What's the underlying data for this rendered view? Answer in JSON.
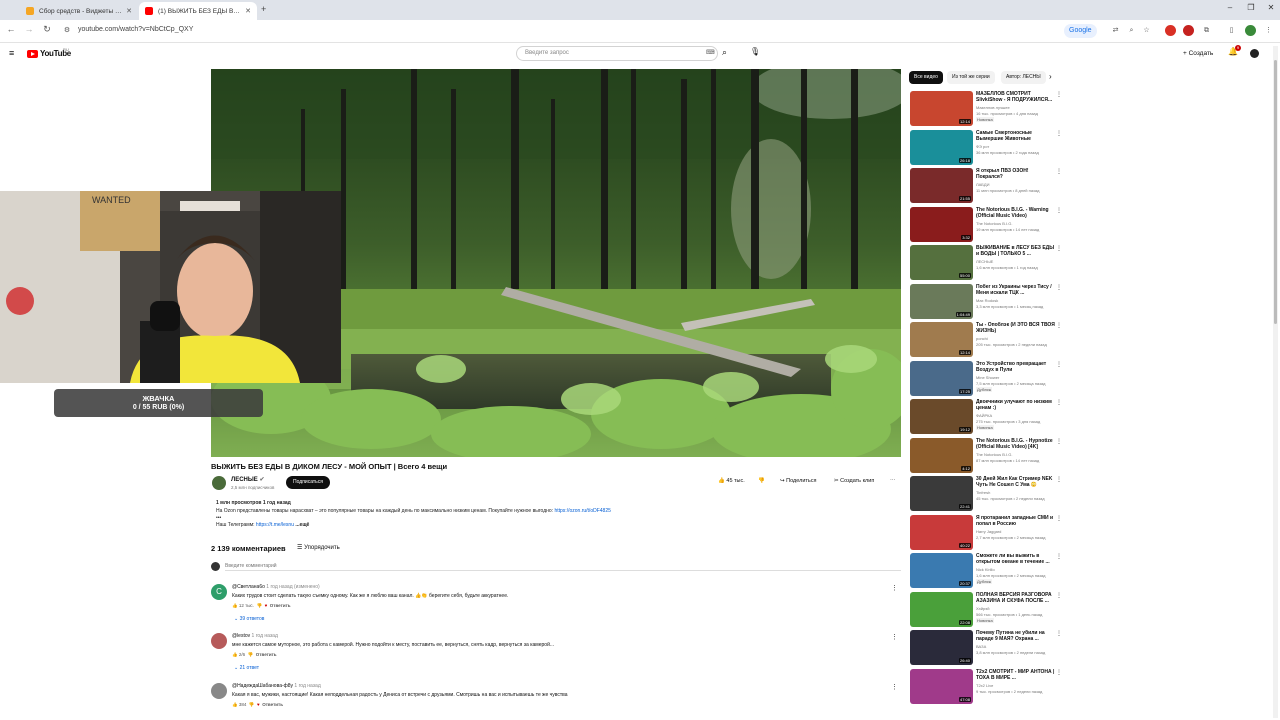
{
  "browser": {
    "tabs": [
      {
        "title": "Сбор средств - Виджеты - Do",
        "favicon_color": "#f5a623",
        "active": false
      },
      {
        "title": "(1) ВЫЖИТЬ БЕЗ ЕДЫ В ДИ",
        "favicon_color": "#ff0000",
        "active": true
      }
    ],
    "new_tab": "+",
    "url": "youtube.com/watch?v=NbCtCp_QXY",
    "google_chip": "Google",
    "window_controls": [
      "–",
      "❐",
      "✕"
    ]
  },
  "youtube_header": {
    "logo_text": "YouTube",
    "region": "RU",
    "search_placeholder": "Введите запрос",
    "create_label": "Создать",
    "notification_count": "9"
  },
  "overlay": {
    "donation_title": "ЖВАЧКА",
    "donation_progress": "0 / 55 RUB (0%)",
    "donation_fraction": 0
  },
  "video": {
    "title": "ВЫЖИТЬ БЕЗ ЕДЫ В ДИКОМ ЛЕСУ - МОЙ ОПЫТ | Всего 4 вещи",
    "channel": "ЛЕСНЫЕ",
    "subscribers": "2,5 млн подписчиков",
    "subscribe_label": "Подписаться",
    "likes": "45 тыс.",
    "share_label": "Поделиться",
    "clip_label": "Создать клип",
    "description": {
      "stats": "1 млн просмотров  1 год назад",
      "line1": "На Ozon представлены товары нарасхват – это популярные товары на каждый день по максимально низким ценам. Покупайте нужное выгодно: ",
      "line1_link": "https://ozon.ru/t/oDF4825",
      "line2": "•••",
      "line3": "Наш Телеграмм: ",
      "line3_link": "https://t.me/lesnu",
      "more": "...ещё"
    }
  },
  "comments_section": {
    "count": "2 139 комментариев",
    "sort_label": "Упорядочить",
    "add_placeholder": "Введите комментарий",
    "comments": [
      {
        "author": "@Светлана6о",
        "date": "1 год назад (изменено)",
        "text": "Каких трудов стоит сделать такую съемку одному. Как же я люблю ваш канал. 👍👏 берегите себя, будьте аккуратнее.",
        "likes": "12 тыс.",
        "reply": "Ответить",
        "replies": "39 ответов",
        "avatar_color": "#2e9e6a",
        "avatar_letter": "С"
      },
      {
        "author": "@lestov",
        "date": "1 год назад",
        "text": "мне кажется самое муторное, это работа с камерой. Нужно подойти к месту, поставить ее, вернуться, снять кадр, вернуться за камерой...",
        "likes": "2/6",
        "reply": "Ответить",
        "replies": "21 ответ",
        "avatar_color": "#b65a5a",
        "avatar_letter": ""
      },
      {
        "author": "@НадеждаШабанова-ф8у",
        "date": "1 год назад",
        "text": "Какая я вас, мужики, настоящие! Какая неподдельная радость у Дениса от встречи с друзьями. Смотришь на вас и испытываешь те же чувства",
        "likes": "384",
        "reply": "Ответить",
        "replies": "",
        "avatar_color": "#888888",
        "avatar_letter": ""
      }
    ]
  },
  "sidebar": {
    "chips": [
      "Все видео",
      "Из той же серии",
      "Автор: ЛЕСНЫ"
    ],
    "recommendations": [
      {
        "title": "МАЗЕЛЛОВ СМОТРИТ SlivkiShow - Я ПОДРУЖИЛСЯ...",
        "channel": "Мазеллов лучшее",
        "meta": "16 тыс. просмотров • 4 дня назад",
        "badge": "Новинка",
        "duration": "12:14",
        "thumb": "#c8462f"
      },
      {
        "title": "Самые Смертоносные Вымершие Животные",
        "channel": "ФЭ рот",
        "meta": "36 млн просмотров • 2 года назад",
        "badge": "",
        "duration": "26:18",
        "thumb": "#1a8f9a"
      },
      {
        "title": "Я открыл ПВЗ ОЗОН! Покрался?",
        "channel": "ЛАБДИ",
        "meta": "11 млн просмотров • 8 дней назад",
        "badge": "",
        "duration": "21:55",
        "thumb": "#7a2a2a"
      },
      {
        "title": "The Notorious B.I.G. - Warning (Official Music Video)",
        "channel": "The Notorious B.I.G.",
        "meta": "19 млн просмотров • 14 лет назад",
        "badge": "",
        "duration": "3:32",
        "thumb": "#8a1c1c"
      },
      {
        "title": "ВЫЖИВАНИЕ в ЛЕСУ БЕЗ ЕДЫ и ВОДЫ | ТОЛЬКО 5 ...",
        "channel": "ЛЕСНЫЕ",
        "meta": "1,6 млн просмотров • 1 год назад",
        "badge": "",
        "duration": "55:00",
        "thumb": "#55703e"
      },
      {
        "title": "Побег из Украины через Тису / Меня искали ТЦК ...",
        "channel": "Max Rodosk",
        "meta": "3,3 млн просмотров • 1 месяц назад",
        "badge": "",
        "duration": "1:04:49",
        "thumb": "#6a7a5a"
      },
      {
        "title": "Ты - Опоблэк (И ЭТО ВСЯ ТВОЯ ЖИЗНЬ)",
        "channel": "ponchi",
        "meta": "205 тыс. просмотров • 2 недели назад",
        "badge": "",
        "duration": "12:14",
        "thumb": "#a07b4e"
      },
      {
        "title": "Это Устройство превращает Воздух в Пули",
        "channel": "Mine Shower",
        "meta": "7,5 млн просмотров • 2 месяца назад",
        "badge": "Дубляж",
        "duration": "17:25",
        "thumb": "#4a6a8a"
      },
      {
        "title": "Двоечники улучают по низким ценам :)",
        "channel": "ФАЙРКА",
        "meta": "275 тыс. просмотров • 3 дня назад",
        "badge": "Новинка",
        "duration": "19:12",
        "thumb": "#6a4a2a"
      },
      {
        "title": "The Notorious B.I.G. - Hypnotize (Official Music Video) [4K]",
        "channel": "The Notorious B.I.G.",
        "meta": "87 млн просмотров • 14 лет назад",
        "badge": "",
        "duration": "4:12",
        "thumb": "#8a5a2a"
      },
      {
        "title": "30 Дней Жил Как Стример NEK Чуть Не Сошел С Ума 😳",
        "channel": "Tinfresh",
        "meta": "45 тыс. просмотров • 2 недели назад",
        "badge": "",
        "duration": "22:41",
        "thumb": "#3a3a3a"
      },
      {
        "title": "Я протаранил западные СМИ и попал в Россию",
        "channel": "Harry Jaggard",
        "meta": "2,7 млн просмотров • 2 месяца назад",
        "badge": "",
        "duration": "40:22",
        "thumb": "#c83a3a"
      },
      {
        "title": "Сможете ли вы выжить в открытом океане в течение ...",
        "channel": "Nick Kirillo",
        "meta": "1,6 млн просмотров • 2 месяца назад",
        "badge": "Дубляж",
        "duration": "20:37",
        "thumb": "#3a7ab0"
      },
      {
        "title": "ПОЛНАЯ ВЕРСИЯ РАЗГОВОРА АЗАЗИНА И СКУФА ПОСЛЕ ...",
        "channel": "Хэйрэй",
        "meta": "566 тыс. просмотров • 1 день назад",
        "badge": "Новинка",
        "duration": "22:08",
        "thumb": "#4aa03a"
      },
      {
        "title": "Почему Путина не убили на параде 9 МАЯ? Охрана ...",
        "channel": "ВАЗА",
        "meta": "3,8 млн просмотров • 2 недели назад",
        "badge": "",
        "duration": "26:40",
        "thumb": "#2a2a3a"
      },
      {
        "title": "T2x2 СМОТРИТ - МИР АНТОНА | ТОХА В МИРЕ ...",
        "channel": "T2x2 Live",
        "meta": "9 тыс. просмотров • 2 недели назад",
        "badge": "",
        "duration": "47:08",
        "thumb": "#a03a8a"
      }
    ]
  }
}
